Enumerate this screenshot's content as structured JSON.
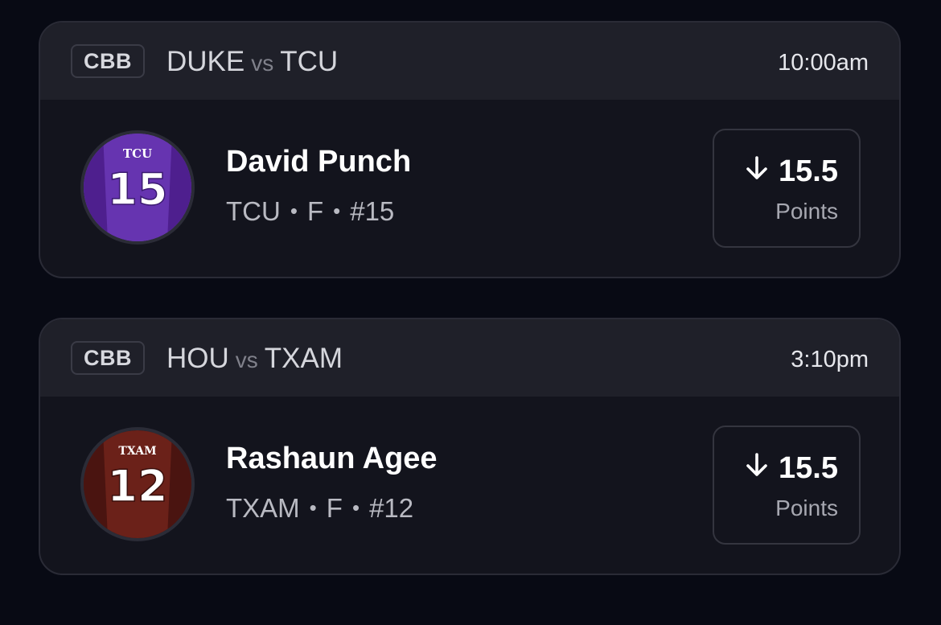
{
  "picks": [
    {
      "league": "CBB",
      "home_team": "DUKE",
      "vs_label": "vs",
      "away_team": "TCU",
      "time": "10:00am",
      "player": {
        "name": "David Punch",
        "team": "TCU",
        "position": "F",
        "number": "#15",
        "jersey_team_text": "TCU",
        "jersey_number_text": "15",
        "jersey_color": "#5b2a9c"
      },
      "prop": {
        "direction_icon": "arrow-down-icon",
        "line": "15.5",
        "stat": "Points"
      }
    },
    {
      "league": "CBB",
      "home_team": "HOU",
      "vs_label": "vs",
      "away_team": "TXAM",
      "time": "3:10pm",
      "player": {
        "name": "Rashaun Agee",
        "team": "TXAM",
        "position": "F",
        "number": "#12",
        "jersey_team_text": "TXAM",
        "jersey_number_text": "12",
        "jersey_color": "#5e1d18"
      },
      "prop": {
        "direction_icon": "arrow-down-icon",
        "line": "15.5",
        "stat": "Points"
      }
    }
  ],
  "separator": "•"
}
